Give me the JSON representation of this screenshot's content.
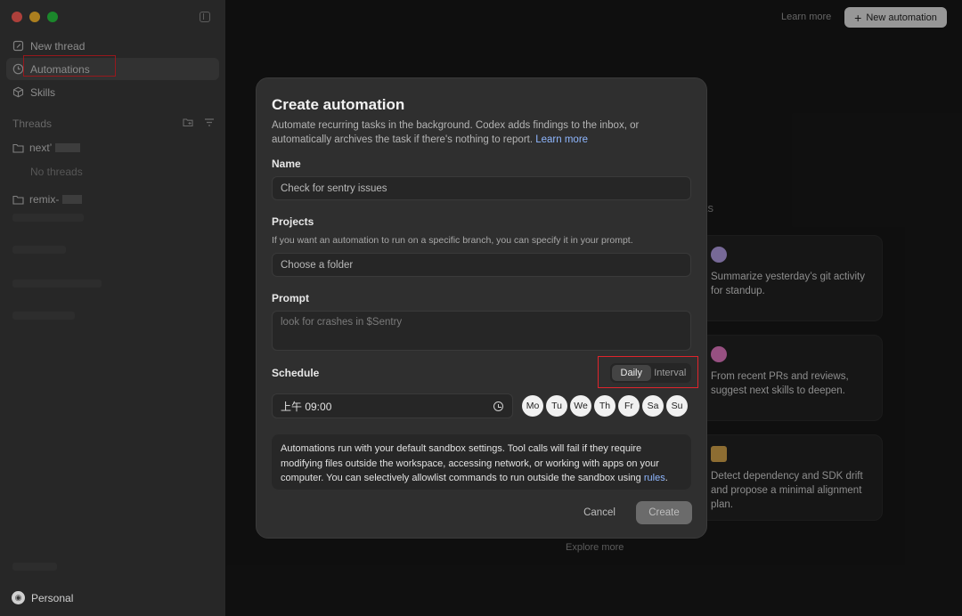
{
  "sidebar": {
    "nav": [
      {
        "label": "New thread",
        "icon": "edit-icon"
      },
      {
        "label": "Automations",
        "icon": "clock-icon"
      },
      {
        "label": "Skills",
        "icon": "cube-icon"
      }
    ],
    "threads_label": "Threads",
    "folders": [
      {
        "name": "next’"
      },
      {
        "name": "remix-"
      }
    ],
    "no_threads": "No threads",
    "account": "Personal"
  },
  "header": {
    "learn_more": "Learn more",
    "new_automation": "New automation"
  },
  "background": {
    "tasks_fragment": "ks",
    "cards": [
      {
        "text": "Summarize yesterday’s git activity for standup.",
        "color": "#b7a2e8"
      },
      {
        "text": "From recent PRs and reviews, suggest next skills to deepen.",
        "color": "#e87bc7"
      },
      {
        "text": "Detect dependency and SDK drift and propose a minimal alignment plan.",
        "color": "#d9a84e"
      }
    ],
    "explore_more": "Explore more"
  },
  "modal": {
    "title": "Create automation",
    "description": "Automate recurring tasks in the background. Codex adds findings to the inbox, or automatically archives the task if there's nothing to report.",
    "description_link": "Learn more",
    "name_label": "Name",
    "name_placeholder": "Check for sentry issues",
    "projects_label": "Projects",
    "projects_hint": "If you want an automation to run on a specific branch, you can specify it in your prompt.",
    "projects_value": "Choose a folder",
    "prompt_label": "Prompt",
    "prompt_placeholder": "look for crashes in $Sentry",
    "schedule_label": "Schedule",
    "schedule_modes": [
      "Daily",
      "Interval"
    ],
    "schedule_selected": "Daily",
    "time_value": "上午 09:00",
    "days": [
      "Mo",
      "Tu",
      "We",
      "Th",
      "Fr",
      "Sa",
      "Su"
    ],
    "notice": "Automations run with your default sandbox settings. Tool calls will fail if they require modifying files outside the workspace, accessing network, or working with apps on your computer. You can selectively allowlist commands to run outside the sandbox using",
    "notice_link": "rules",
    "notice_end": ".",
    "cancel": "Cancel",
    "create": "Create"
  },
  "colors": {
    "traffic_red": "#ff5f57",
    "traffic_yellow": "#febc2e",
    "traffic_green": "#28c840",
    "link": "#8fb7ff",
    "highlight_outline": "#e0242c"
  }
}
